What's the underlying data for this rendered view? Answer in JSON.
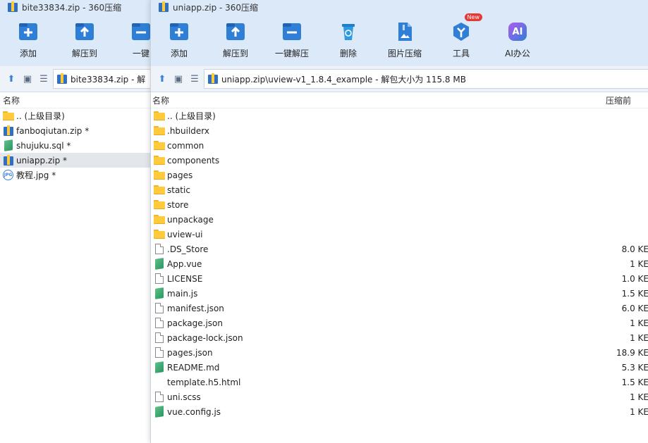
{
  "back_window": {
    "title": "bite33834.zip - 360压缩",
    "toolbar": [
      {
        "label": "添加",
        "icon": "add-icon"
      },
      {
        "label": "解压到",
        "icon": "extract-to-icon"
      },
      {
        "label": "一键",
        "icon": "one-click-extract-icon"
      }
    ],
    "address": "bite33834.zip - 解",
    "column_name": "名称",
    "rows": [
      {
        "name": ".. (上级目录)",
        "icon": "folder-icon"
      },
      {
        "name": "fanboqiutan.zip *",
        "icon": "zip-icon"
      },
      {
        "name": "shujuku.sql *",
        "icon": "green-file-icon"
      },
      {
        "name": "uniapp.zip *",
        "icon": "zip-icon",
        "selected": true
      },
      {
        "name": "教程.jpg *",
        "icon": "jpg-icon"
      }
    ]
  },
  "front_window": {
    "title": "uniapp.zip - 360压缩",
    "toolbar": [
      {
        "label": "添加",
        "icon": "add-icon"
      },
      {
        "label": "解压到",
        "icon": "extract-to-icon"
      },
      {
        "label": "一键解压",
        "icon": "one-click-extract-icon"
      },
      {
        "label": "删除",
        "icon": "delete-icon"
      },
      {
        "label": "图片压缩",
        "icon": "image-compress-icon"
      },
      {
        "label": "工具",
        "icon": "tools-icon",
        "badge": "New"
      },
      {
        "label": "AI办公",
        "icon": "ai-office-icon",
        "glyph": "AI"
      }
    ],
    "address": "uniapp.zip\\uview-v1_1.8.4_example - 解包大小为 115.8 MB",
    "column_name": "名称",
    "column_size": "压缩前",
    "rows": [
      {
        "name": ".. (上级目录)",
        "icon": "folder-icon",
        "size": ""
      },
      {
        "name": ".hbuilderx",
        "icon": "folder-icon",
        "size": ""
      },
      {
        "name": "common",
        "icon": "folder-icon",
        "size": ""
      },
      {
        "name": "components",
        "icon": "folder-icon",
        "size": ""
      },
      {
        "name": "pages",
        "icon": "folder-icon",
        "size": ""
      },
      {
        "name": "static",
        "icon": "folder-icon",
        "size": ""
      },
      {
        "name": "store",
        "icon": "folder-icon",
        "size": ""
      },
      {
        "name": "unpackage",
        "icon": "folder-icon",
        "size": ""
      },
      {
        "name": "uview-ui",
        "icon": "folder-icon",
        "size": ""
      },
      {
        "name": ".DS_Store",
        "icon": "document-icon",
        "size": "8.0 KE"
      },
      {
        "name": "App.vue",
        "icon": "green-file-icon",
        "size": "1 KE"
      },
      {
        "name": "LICENSE",
        "icon": "document-icon",
        "size": "1.0 KE"
      },
      {
        "name": "main.js",
        "icon": "green-file-icon",
        "size": "1.5 KE"
      },
      {
        "name": "manifest.json",
        "icon": "document-icon",
        "size": "6.0 KE"
      },
      {
        "name": "package.json",
        "icon": "document-icon",
        "size": "1 KE"
      },
      {
        "name": "package-lock.json",
        "icon": "document-icon",
        "size": "1 KE"
      },
      {
        "name": "pages.json",
        "icon": "document-icon",
        "size": "18.9 KE"
      },
      {
        "name": "README.md",
        "icon": "green-file-icon",
        "size": "5.3 KE"
      },
      {
        "name": "template.h5.html",
        "icon": "blank-icon",
        "size": "1.5 KE"
      },
      {
        "name": "uni.scss",
        "icon": "document-icon",
        "size": "1 KE"
      },
      {
        "name": "vue.config.js",
        "icon": "green-file-icon",
        "size": "1 KE"
      }
    ]
  },
  "colors": {
    "toolbar_bg": "#dbe9f8",
    "accent": "#2f7fd6",
    "selected_row": "#e3e6ea"
  }
}
